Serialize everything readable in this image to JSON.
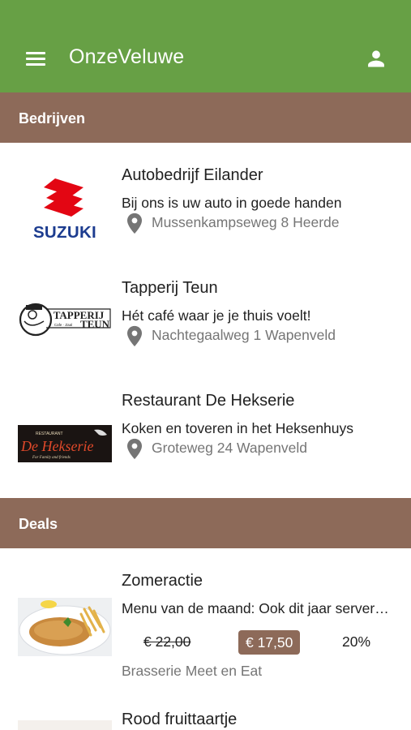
{
  "app": {
    "title": "OnzeVeluwe",
    "colors": {
      "appbar": "#67a045",
      "section_header": "#8d6a59",
      "price_badge": "#8d6a59"
    },
    "icons": {
      "menu": "menu-icon",
      "account": "account-icon",
      "location": "location-pin-icon"
    }
  },
  "sections": {
    "businesses": "Bedrijven",
    "deals": "Deals"
  },
  "businesses": [
    {
      "logo_text": "SUZUKI",
      "name": "Autobedrijf Eilander",
      "description": "Bij ons is uw auto in goede handen",
      "address": "Mussenkampseweg 8 Heerde"
    },
    {
      "logo_text": "TAPPERIJ TEUN",
      "name": "Tapperij Teun",
      "description": "Hét café waar je je thuis voelt!",
      "address": "Nachtegaalweg 1 Wapenveld"
    },
    {
      "logo_text": "De Hekserie",
      "name": "Restaurant De Hekserie",
      "description": "Koken en toveren in het Heksenhuys",
      "address": "Groteweg 24 Wapenveld"
    }
  ],
  "deals": [
    {
      "name": "Zomeractie",
      "description": "Menu van de maand: Ook dit jaar serveren wij weer",
      "old_price": "€ 22,00",
      "new_price": "€ 17,50",
      "discount": "20%",
      "vendor": "Brasserie Meet en Eat"
    },
    {
      "name": "Rood fruittaartje"
    }
  ]
}
